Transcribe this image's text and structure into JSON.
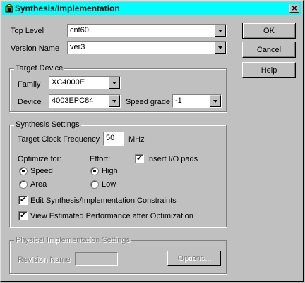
{
  "window": {
    "title": "Synthesis/Implementation",
    "close": "×"
  },
  "top_level": {
    "label": "Top Level",
    "value": "cnt60"
  },
  "version_name": {
    "label": "Version Name",
    "value": "ver3"
  },
  "buttons": {
    "ok": "OK",
    "cancel": "Cancel",
    "help": "Help"
  },
  "target_device": {
    "title": "Target Device",
    "family_label": "Family",
    "family_value": "XC4000E",
    "device_label": "Device",
    "device_value": "4003EPC84",
    "speed_label": "Speed grade",
    "speed_value": "-1"
  },
  "synthesis": {
    "title": "Synthesis Settings",
    "clock_label": "Target Clock Frequency",
    "clock_value": "50",
    "clock_unit": "MHz",
    "optimize_label": "Optimize for:",
    "opt_speed": "Speed",
    "opt_area": "Area",
    "optimize_selected": "Speed",
    "effort_label": "Effort:",
    "effort_high": "High",
    "effort_low": "Low",
    "effort_selected": "High",
    "insert_io": "Insert I/O pads",
    "insert_io_checked": true,
    "edit_constraints": "Edit Synthesis/Implementation Constraints",
    "edit_constraints_checked": true,
    "view_perf": "View Estimated Performance after Optimization",
    "view_perf_checked": true
  },
  "physical": {
    "title": "Physical Implementation Settings",
    "revision_label": "Revision Name",
    "revision_value": "",
    "options_button": "Options..."
  }
}
